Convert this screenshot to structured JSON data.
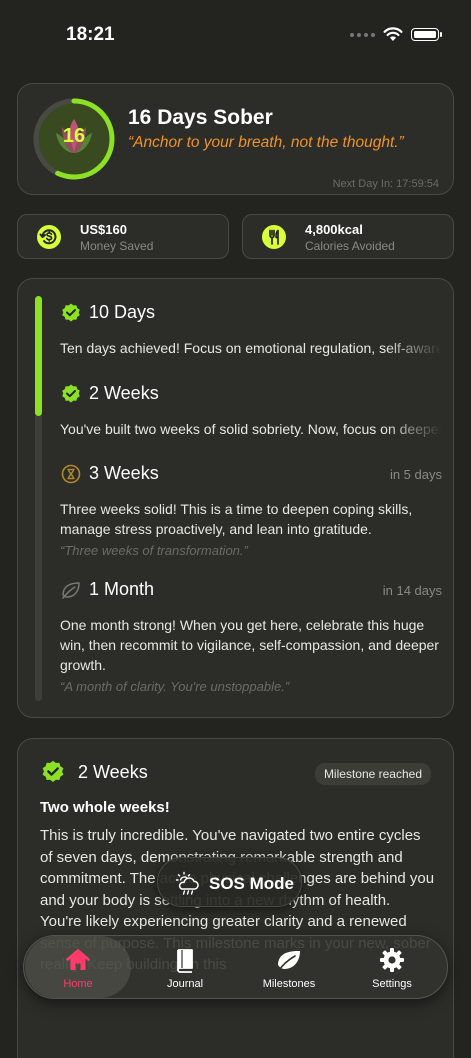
{
  "status_bar": {
    "time": "18:21"
  },
  "hero": {
    "day_count": "16",
    "title": "16 Days Sober",
    "quote": "“Anchor to your breath, not the thought.”",
    "next_day": "Next Day In: 17:59:54",
    "progress_fraction": 0.57,
    "colors": {
      "accent": "#8ce125",
      "quote": "#f0932b"
    }
  },
  "stats": [
    {
      "value": "US$160",
      "label": "Money Saved",
      "icon": "dollar-refresh-icon"
    },
    {
      "value": "4,800kcal",
      "label": "Calories Avoided",
      "icon": "fork-knife-icon"
    }
  ],
  "timeline": {
    "milestones": [
      {
        "title": "10 Days",
        "status": "achieved",
        "icon": "check-badge-icon",
        "in": "",
        "description": "Ten days achieved! Focus on emotional regulation, self-awareness and steady routines.",
        "quote": ""
      },
      {
        "title": "2 Weeks",
        "status": "achieved",
        "icon": "check-badge-icon",
        "in": "",
        "description": "You've built two weeks of solid sobriety. Now, focus on deepening your habits.",
        "quote": ""
      },
      {
        "title": "3 Weeks",
        "status": "upcoming",
        "icon": "hourglass-icon",
        "in": "in 5 days",
        "description": "Three weeks solid! This is a time to deepen coping skills, manage stress proactively, and lean into gratitude.",
        "quote": "“Three weeks of transformation.”"
      },
      {
        "title": "1 Month",
        "status": "upcoming",
        "icon": "leaf-icon",
        "in": "in 14 days",
        "description": "One month strong! When you get here, celebrate this huge win, then recommit to vigilance, self-compassion, and deeper growth.",
        "quote": "“A month of clarity. You're unstoppable.”"
      }
    ]
  },
  "detail": {
    "title": "2 Weeks",
    "badge": "Milestone reached",
    "subtitle": "Two whole weeks!",
    "body": "This is truly incredible. You've navigated two entire cycles of seven days, demonstrating remarkable strength and commitment. The acute physical challenges are behind you and your body is settling into a new rhythm of health. You're likely experiencing greater clarity and a renewed sense of purpose. This milestone marks in your new, sober reality. Keep building on this"
  },
  "sos": {
    "label": "SOS Mode",
    "icon": "storm-cloud-icon"
  },
  "tabs": [
    {
      "label": "Home",
      "icon": "home-icon",
      "active": true
    },
    {
      "label": "Journal",
      "icon": "book-icon",
      "active": false
    },
    {
      "label": "Milestones",
      "icon": "leaf-icon",
      "active": false
    },
    {
      "label": "Settings",
      "icon": "gear-icon",
      "active": false
    }
  ]
}
